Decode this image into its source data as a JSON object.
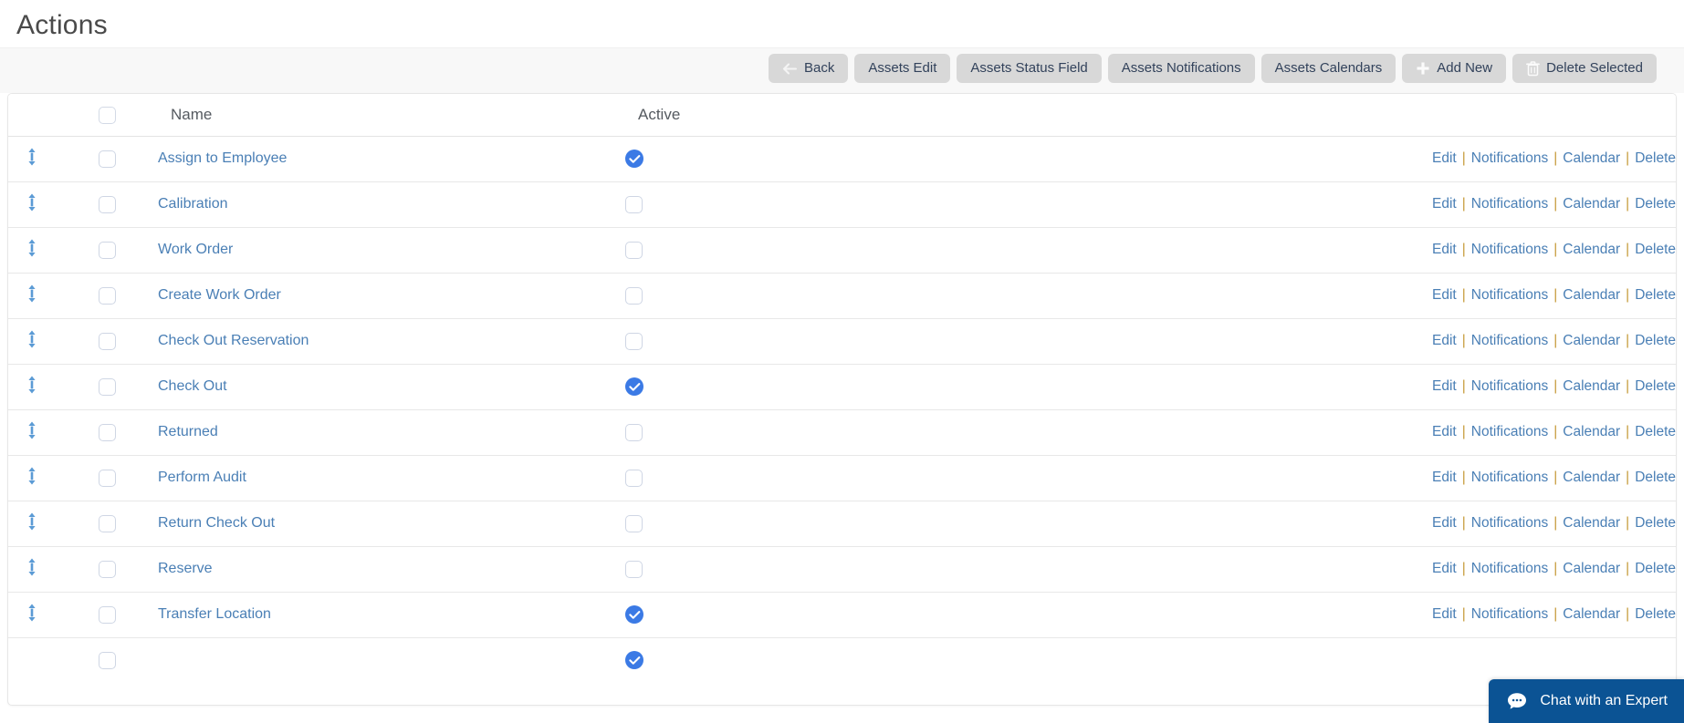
{
  "page": {
    "title": "Actions"
  },
  "toolbar": {
    "buttons": [
      {
        "label": "Back",
        "icon": "arrow-left-icon"
      },
      {
        "label": "Assets Edit",
        "icon": null
      },
      {
        "label": "Assets Status Field",
        "icon": null
      },
      {
        "label": "Assets Notifications",
        "icon": null
      },
      {
        "label": "Assets Calendars",
        "icon": null
      },
      {
        "label": "Add New",
        "icon": "plus-icon"
      },
      {
        "label": "Delete Selected",
        "icon": "trash-icon"
      }
    ]
  },
  "table": {
    "columns": {
      "name": "Name",
      "active": "Active"
    },
    "row_actions": {
      "edit": "Edit",
      "notifications": "Notifications",
      "calendar": "Calendar",
      "delete": "Delete",
      "separator": "|"
    },
    "select_all_checked": false,
    "rows": [
      {
        "name": "Assign to Employee",
        "active": true,
        "selected": false
      },
      {
        "name": "Calibration",
        "active": false,
        "selected": false
      },
      {
        "name": "Work Order",
        "active": false,
        "selected": false
      },
      {
        "name": "Create Work Order",
        "active": false,
        "selected": false
      },
      {
        "name": "Check Out Reservation",
        "active": false,
        "selected": false
      },
      {
        "name": "Check Out",
        "active": true,
        "selected": false
      },
      {
        "name": "Returned",
        "active": false,
        "selected": false
      },
      {
        "name": "Perform Audit",
        "active": false,
        "selected": false
      },
      {
        "name": "Return Check Out",
        "active": false,
        "selected": false
      },
      {
        "name": "Reserve",
        "active": false,
        "selected": false
      },
      {
        "name": "Transfer Location",
        "active": true,
        "selected": false
      },
      {
        "name": "",
        "active": true,
        "selected": false
      }
    ]
  },
  "chat": {
    "label": "Chat with an Expert",
    "icon": "chat-bubble-icon"
  },
  "colors": {
    "link": "#4a7fb5",
    "active_on": "#3b7ae5",
    "button_bg": "#d8d8d8",
    "button_text": "#32425b",
    "separator": "#c69b3a",
    "chat_bg": "#0b5394",
    "toolbar_bg": "#f8f8f8"
  }
}
